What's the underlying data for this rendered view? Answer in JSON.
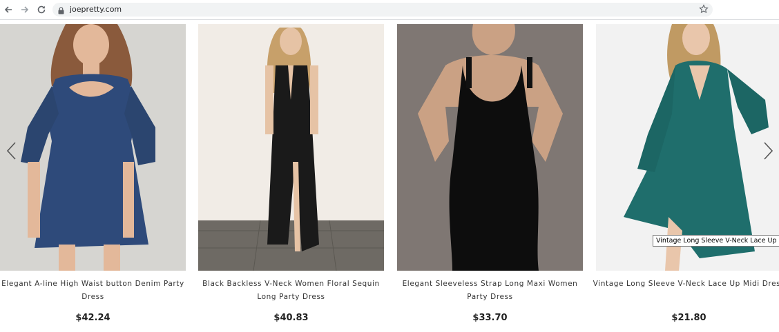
{
  "browser": {
    "url": "joepretty.com",
    "icons": [
      "back-arrow-icon",
      "forward-arrow-icon",
      "reload-icon",
      "lock-icon",
      "bookmark-star-icon"
    ]
  },
  "products": [
    {
      "title": "Elegant A-line High Waist button Denim Party Dress",
      "price": "$42.24",
      "dress_color": "#2e4a7a"
    },
    {
      "title": "Black Backless V-Neck Women Floral Sequin Long Party Dress",
      "price": "$40.83",
      "dress_color": "#1a1a1a"
    },
    {
      "title": "Elegant Sleeveless Strap Long Maxi Women Party Dress",
      "price": "$33.70",
      "dress_color": "#0d0d0d"
    },
    {
      "title": "Vintage Long Sleeve V-Neck Lace Up Midi Dress",
      "price": "$21.80",
      "dress_color": "#1f6e6c"
    }
  ],
  "carousel": {
    "prev_icon": "chevron-left-icon",
    "next_icon": "chevron-right-icon"
  },
  "tooltip": "Vintage Long Sleeve V-Neck Lace Up Midi Dress"
}
